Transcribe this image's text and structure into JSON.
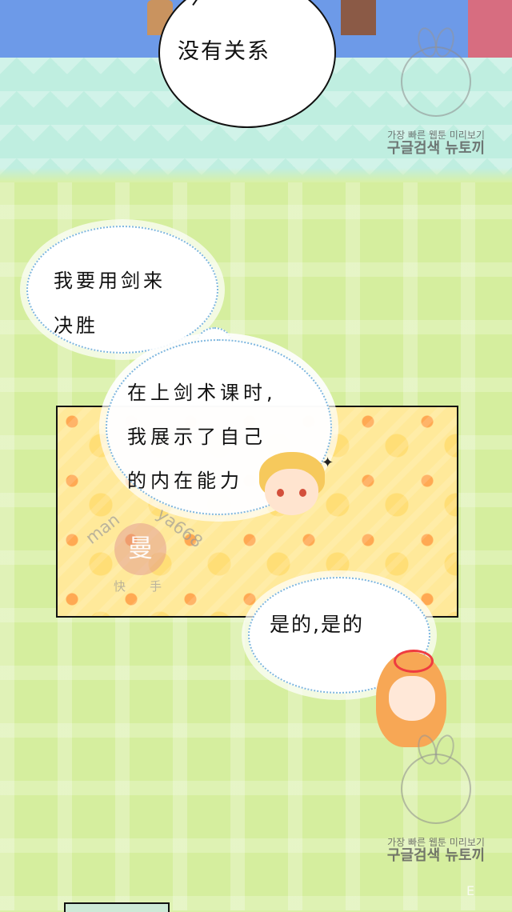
{
  "speech": {
    "top": "没有关系",
    "cloud_lines": [
      "我要用剑来",
      "决胜"
    ],
    "panel_lines": [
      "在上剑术课时,",
      "我展示了自己",
      "的内在能力"
    ],
    "reply": "是的,是的"
  },
  "watermark": {
    "small": "가장 빠른 웹툰 미리보기",
    "large": "구글검색 뉴토끼",
    "stamp": "曼",
    "stamp_left": "man",
    "stamp_right": "ya668",
    "stamp_bottom": "快手"
  },
  "icons": {
    "sparkle": "✦",
    "corner": "E"
  }
}
